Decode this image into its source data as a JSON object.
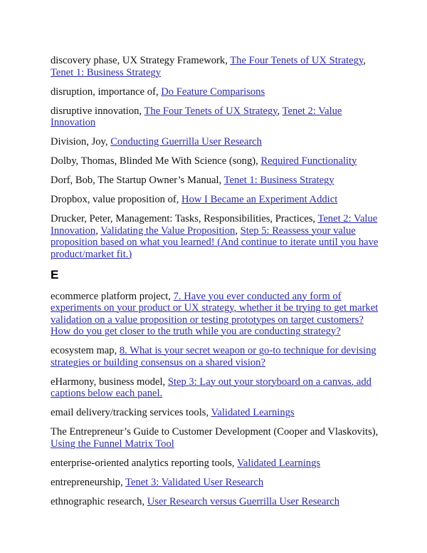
{
  "link_color": "#2b2ba8",
  "entries_d": [
    {
      "term": "discovery phase, UX Strategy Framework",
      "links": [
        "The Four Tenets of UX Strategy",
        "Tenet 1: Business Strategy"
      ]
    },
    {
      "term": "disruption, importance of",
      "links": [
        "Do Feature Comparisons"
      ]
    },
    {
      "term": "disruptive innovation",
      "links": [
        "The Four Tenets of UX Strategy",
        "Tenet 2: Value Innovation"
      ]
    },
    {
      "term": "Division, Joy",
      "links": [
        "Conducting Guerrilla User Research"
      ]
    },
    {
      "term": "Dolby, Thomas, Blinded Me With Science (song)",
      "links": [
        "Required Functionality"
      ]
    },
    {
      "term": "Dorf, Bob, The Startup Owner’s Manual",
      "links": [
        "Tenet 1: Business Strategy"
      ]
    },
    {
      "term": "Dropbox, value proposition of",
      "links": [
        "How I Became an Experiment Addict"
      ]
    },
    {
      "term": "Drucker, Peter, Management: Tasks, Responsibilities, Practices",
      "links": [
        "Tenet 2: Value Innovation",
        "Validating the Value Proposition",
        "Step 5: Reassess your value proposition based on what you learned! (And continue to iterate until you have product/market fit.)"
      ]
    }
  ],
  "section_e": {
    "heading": "E"
  },
  "entries_e": [
    {
      "term": "ecommerce platform project",
      "links": [
        "7. Have you ever conducted any form of experiments on your product or UX strategy, whether it be trying to get market validation on a value proposition or testing prototypes on target customers? How do you get closer to the truth while you are conducting strategy?"
      ]
    },
    {
      "term": "ecosystem map",
      "links": [
        "8. What is your secret weapon or go-to technique for devising strategies or building consensus on a shared vision?"
      ]
    },
    {
      "term": "eHarmony, business model",
      "links": [
        "Step 3: Lay out your storyboard on a canvas, add captions below each panel."
      ]
    },
    {
      "term": "email delivery/tracking services tools",
      "links": [
        "Validated Learnings"
      ]
    },
    {
      "term": "The Entrepreneur’s Guide to Customer Development (Cooper and Vlaskovits)",
      "links": [
        "Using the Funnel Matrix Tool"
      ]
    },
    {
      "term": "enterprise-oriented analytics reporting tools",
      "links": [
        "Validated Learnings"
      ]
    },
    {
      "term": "entrepreneurship",
      "links": [
        "Tenet 3: Validated User Research"
      ]
    },
    {
      "term": "ethnographic research",
      "links": [
        "User Research versus Guerrilla User Research"
      ]
    }
  ]
}
